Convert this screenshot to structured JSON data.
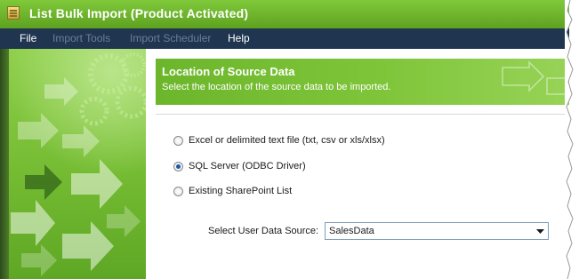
{
  "window": {
    "title": "List Bulk Import (Product Activated)"
  },
  "menu": {
    "items": [
      {
        "label": "File",
        "enabled": true
      },
      {
        "label": "Import Tools",
        "enabled": false
      },
      {
        "label": "Import Scheduler",
        "enabled": false
      },
      {
        "label": "Help",
        "enabled": true
      }
    ]
  },
  "header": {
    "title": "Location of Source Data",
    "subtitle": "Select the location of the source data to be imported."
  },
  "source_options": [
    {
      "label": "Excel or delimited text file (txt, csv or xls/xlsx)",
      "selected": false
    },
    {
      "label": "SQL Server (ODBC Driver)",
      "selected": true
    },
    {
      "label": "Existing SharePoint List",
      "selected": false
    }
  ],
  "data_source": {
    "label": "Select User Data Source:",
    "value": "SalesData"
  },
  "colors": {
    "titlebar": "#6cb62b",
    "menubar": "#1f3550",
    "header": "#7fc53a",
    "radio_selected": "#1b56a8"
  },
  "icons": {
    "app": "app-icon",
    "dropdown": "chevron-down-icon",
    "sidebar_art": "arrows-decoration"
  }
}
